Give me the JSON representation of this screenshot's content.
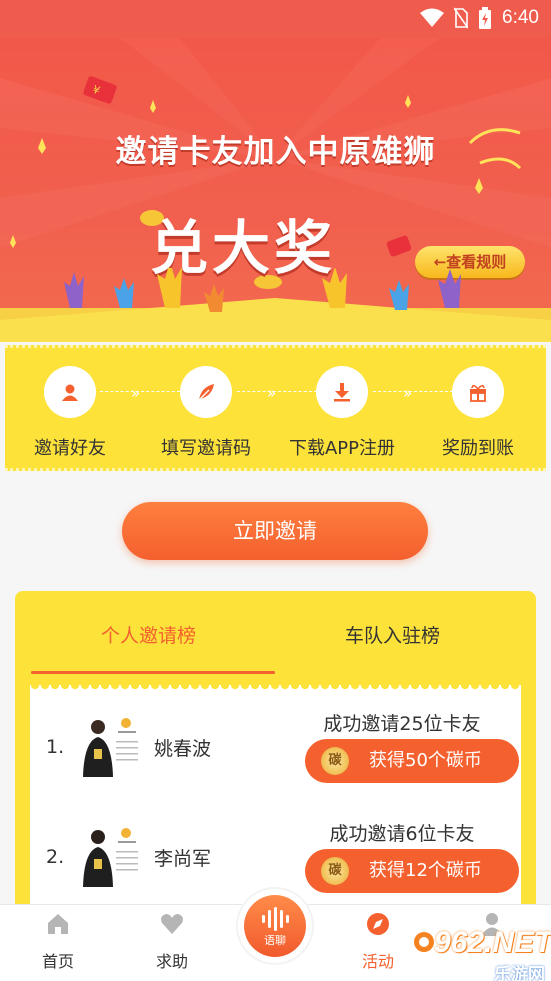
{
  "status_bar": {
    "time": "6:40"
  },
  "hero": {
    "title_line1": "邀请卡友加入中原雄狮",
    "title_line2": "兑大奖",
    "rules_button": "←查看规则"
  },
  "steps": [
    {
      "label": "邀请好友",
      "icon": "user-icon"
    },
    {
      "label": "填写邀请码",
      "icon": "feather-pen-icon"
    },
    {
      "label": "下载APP注册",
      "icon": "download-icon"
    },
    {
      "label": "奖励到账",
      "icon": "gift-icon"
    }
  ],
  "invite_button": "立即邀请",
  "rank": {
    "tabs": [
      {
        "label": "个人邀请榜",
        "active": true
      },
      {
        "label": "车队入驻榜",
        "active": false
      }
    ],
    "rows": [
      {
        "rank": "1.",
        "name": "姚春波",
        "success": "成功邀请25位卡友",
        "coin_glyph": "碳",
        "reward": "获得50个碳币"
      },
      {
        "rank": "2.",
        "name": "李尚军",
        "success": "成功邀请6位卡友",
        "coin_glyph": "碳",
        "reward": "获得12个碳币"
      }
    ]
  },
  "bottom_nav": {
    "items": [
      {
        "label": "首页",
        "icon": "home-icon",
        "active": false
      },
      {
        "label": "求助",
        "icon": "heart-icon",
        "active": false
      },
      {
        "label": "活动",
        "icon": "compass-icon",
        "active": true
      },
      {
        "label": "",
        "icon": "profile-icon",
        "active": false
      }
    ],
    "center_label": "语聊"
  },
  "watermark": {
    "text": "962.NET",
    "sub": "乐游网"
  },
  "colors": {
    "accent": "#f4602e",
    "banner": "#f25849",
    "yellow": "#fde23a",
    "active_tab": "#f2612f"
  }
}
